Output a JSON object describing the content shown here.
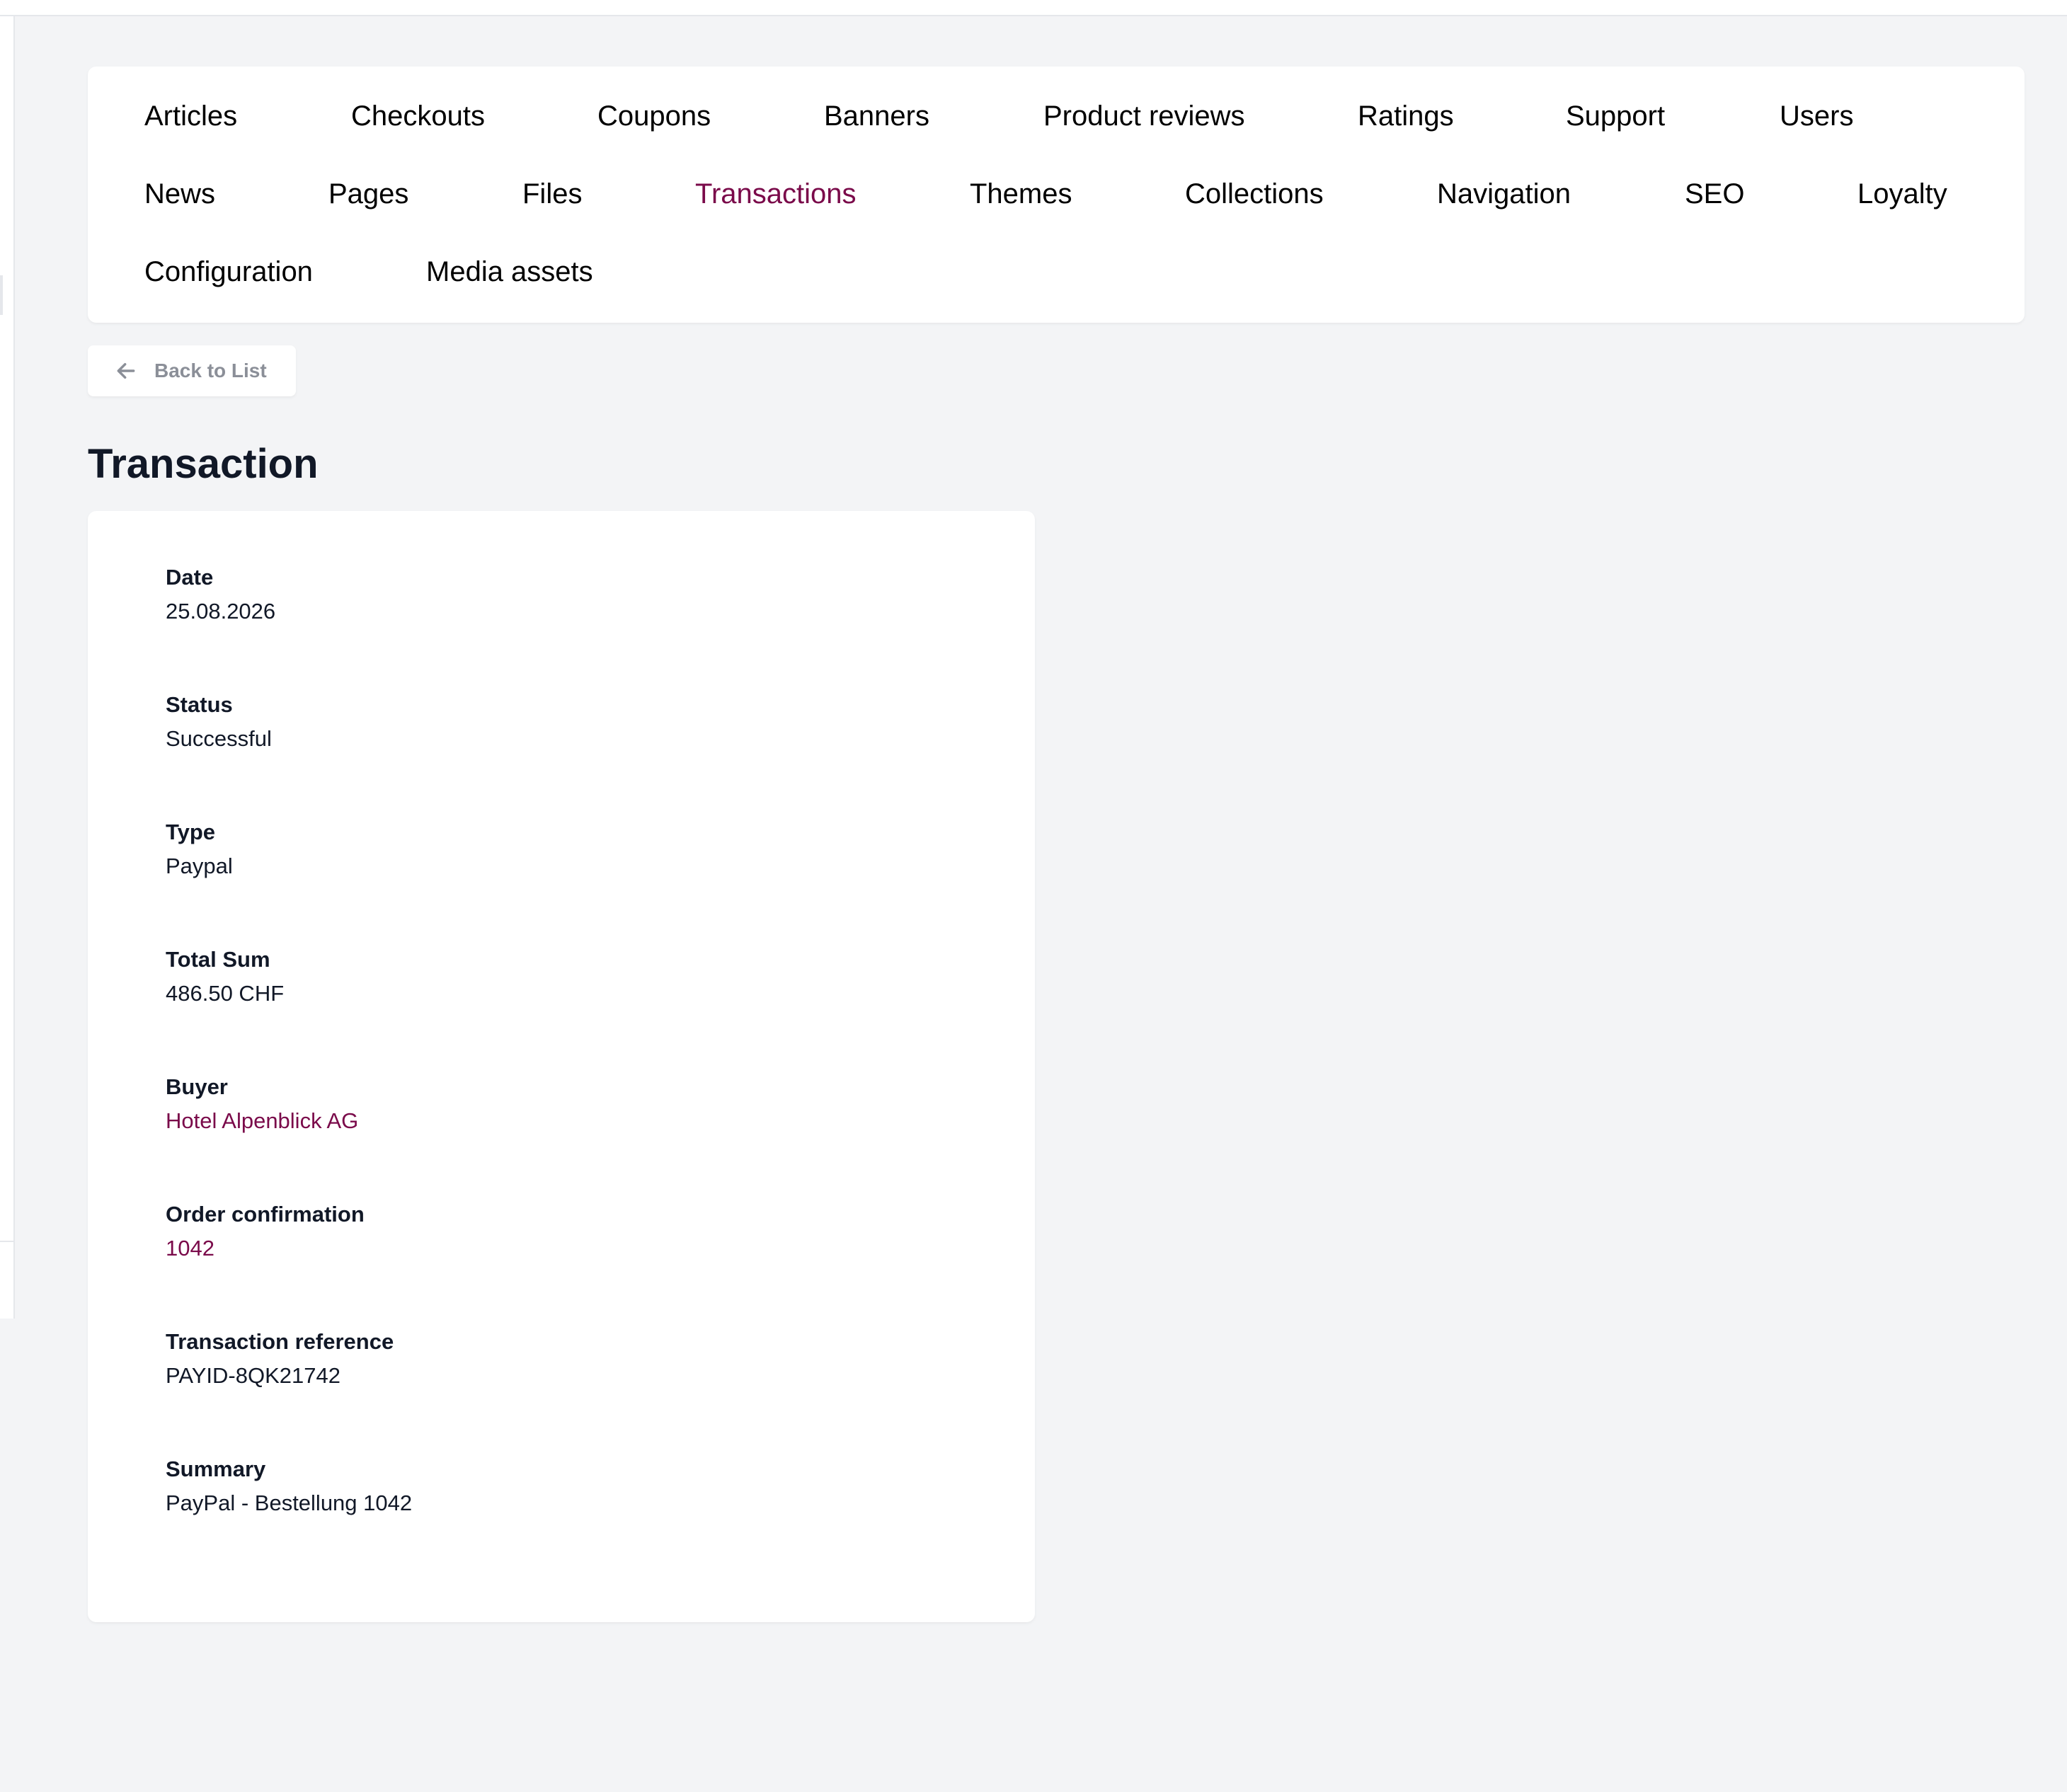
{
  "nav": {
    "items": [
      {
        "label": "Articles",
        "active": false
      },
      {
        "label": "Checkouts",
        "active": false
      },
      {
        "label": "Coupons",
        "active": false
      },
      {
        "label": "Banners",
        "active": false
      },
      {
        "label": "Product reviews",
        "active": false
      },
      {
        "label": "Ratings",
        "active": false
      },
      {
        "label": "Support",
        "active": false
      },
      {
        "label": "Users",
        "active": false
      },
      {
        "label": "News",
        "active": false
      },
      {
        "label": "Pages",
        "active": false
      },
      {
        "label": "Files",
        "active": false
      },
      {
        "label": "Transactions",
        "active": true
      },
      {
        "label": "Themes",
        "active": false
      },
      {
        "label": "Collections",
        "active": false
      },
      {
        "label": "Navigation",
        "active": false
      },
      {
        "label": "SEO",
        "active": false
      },
      {
        "label": "Loyalty",
        "active": false
      },
      {
        "label": "Configuration",
        "active": false
      },
      {
        "label": "Media assets",
        "active": false
      }
    ]
  },
  "back_button": {
    "label": "Back to List",
    "icon": "arrow-left-icon"
  },
  "page": {
    "title": "Transaction"
  },
  "details": {
    "date": {
      "label": "Date",
      "value": "25.08.2026"
    },
    "status": {
      "label": "Status",
      "value": "Successful"
    },
    "type": {
      "label": "Type",
      "value": "Paypal"
    },
    "total_sum": {
      "label": "Total Sum",
      "value": "486.50 CHF"
    },
    "buyer": {
      "label": "Buyer",
      "value": "Hotel Alpenblick AG"
    },
    "order_confirmation": {
      "label": "Order confirmation",
      "value": "1042"
    },
    "transaction_reference": {
      "label": "Transaction reference",
      "value": "PAYID-8QK21742"
    },
    "summary": {
      "label": "Summary",
      "value": "PayPal - Bestellung 1042"
    }
  },
  "colors": {
    "accent": "#7a0a4a",
    "background": "#f3f4f6",
    "card": "#ffffff",
    "muted_text": "#8b8f98"
  }
}
